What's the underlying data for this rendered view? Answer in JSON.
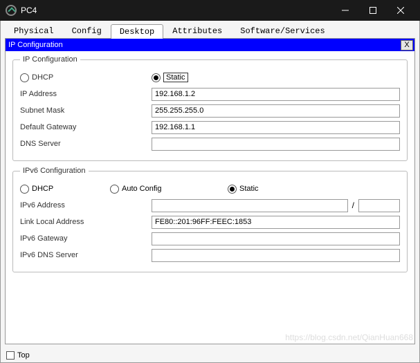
{
  "window": {
    "title": "PC4"
  },
  "tabs": [
    "Physical",
    "Config",
    "Desktop",
    "Attributes",
    "Software/Services"
  ],
  "active_tab": 2,
  "module": {
    "title": "IP Configuration",
    "close": "X"
  },
  "ipcfg": {
    "legend": "IP Configuration",
    "dhcp_label": "DHCP",
    "static_label": "Static",
    "mode": "static",
    "ip_label": "IP Address",
    "ip_value": "192.168.1.2",
    "subnet_label": "Subnet Mask",
    "subnet_value": "255.255.255.0",
    "gateway_label": "Default Gateway",
    "gateway_value": "192.168.1.1",
    "dns_label": "DNS Server",
    "dns_value": ""
  },
  "ipv6": {
    "legend": "IPv6 Configuration",
    "dhcp_label": "DHCP",
    "auto_label": "Auto Config",
    "static_label": "Static",
    "mode": "static",
    "addr_label": "IPv6 Address",
    "addr_value": "",
    "prefix_value": "",
    "lla_label": "Link Local Address",
    "lla_value": "FE80::201:96FF:FEEC:1853",
    "gw_label": "IPv6 Gateway",
    "gw_value": "",
    "dns_label": "IPv6 DNS Server",
    "dns_value": ""
  },
  "footer": {
    "top_label": "Top",
    "top_checked": false
  },
  "watermark": "https://blog.csdn.net/QianHuan668"
}
